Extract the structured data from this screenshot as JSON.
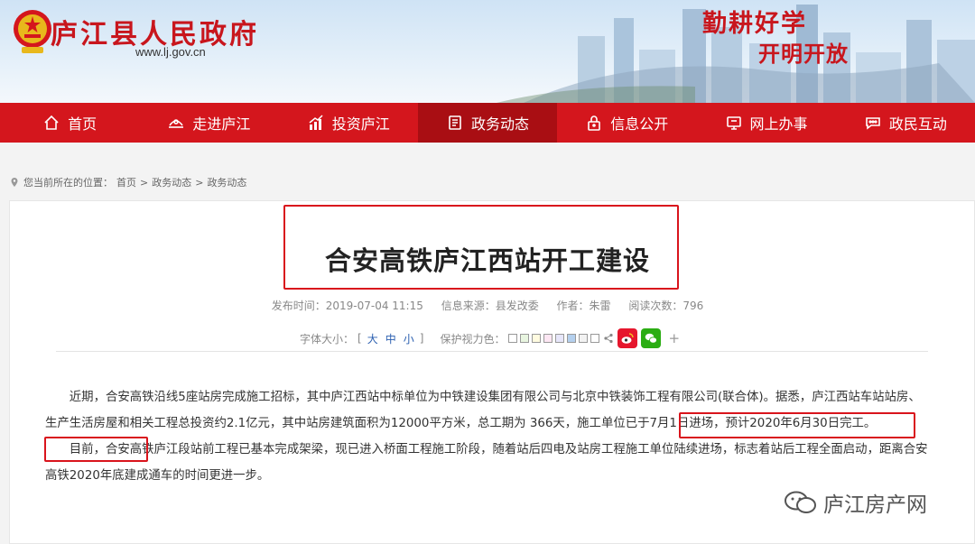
{
  "site": {
    "title": "庐江县人民政府",
    "url": "www.lj.gov.cn",
    "slogan_line1": "勤耕好学",
    "slogan_line2": "开明开放"
  },
  "nav": {
    "items": [
      {
        "label": "首页",
        "icon": "home-icon"
      },
      {
        "label": "走进庐江",
        "icon": "landmark-icon"
      },
      {
        "label": "投资庐江",
        "icon": "chart-icon"
      },
      {
        "label": "政务动态",
        "icon": "document-icon",
        "active": true
      },
      {
        "label": "信息公开",
        "icon": "lock-icon"
      },
      {
        "label": "网上办事",
        "icon": "monitor-icon"
      },
      {
        "label": "政民互动",
        "icon": "chat-icon"
      }
    ]
  },
  "breadcrumb": {
    "prefix": "您当前所在的位置：",
    "items": [
      "首页",
      "政务动态",
      "政务动态"
    ],
    "separator": ">"
  },
  "article": {
    "title": "合安高铁庐江西站开工建设",
    "meta": {
      "publish_time": "发布时间：2019-07-04 11:15",
      "source": "信息来源：县发改委",
      "author": "作者：朱雷",
      "views": "阅读次数：796"
    },
    "font_size_label": "字体大小：",
    "font_sizes": [
      "大",
      "中",
      "小"
    ],
    "eye_care_label": "保护视力色：",
    "eye_care_colors": [
      "#ffffff",
      "#e8f5e0",
      "#fffbe0",
      "#fde6f3",
      "#e6e6fa",
      "#b4d0ee",
      "#f2f2f2",
      "#ffffff"
    ],
    "share_plus": "+",
    "paragraphs": [
      "近期，合安高铁沿线5座站房完成施工招标，其中庐江西站中标单位为中铁建设集团有限公司与北京中铁装饰工程有限公司(联合体)。据悉，庐江西站车站站房、生产生活房屋和相关工程总投资约2.1亿元，其中站房建筑面积为12000平方米，总工期为 366天，施工单位已于7月1日进场，预计2020年6月30日完工。",
      "目前，合安高铁庐江段站前工程已基本完成架梁，现已进入桥面工程施工阶段，随着站后四电及站房工程施工单位陆续进场，标志着站后工程全面启动，距离合安高铁2020年底建成通车的时间更进一步。"
    ]
  },
  "watermark": "庐江房产网",
  "colors": {
    "brand_red": "#d4161d",
    "nav_active": "#a90e13",
    "highlight_border": "#d9141c"
  }
}
